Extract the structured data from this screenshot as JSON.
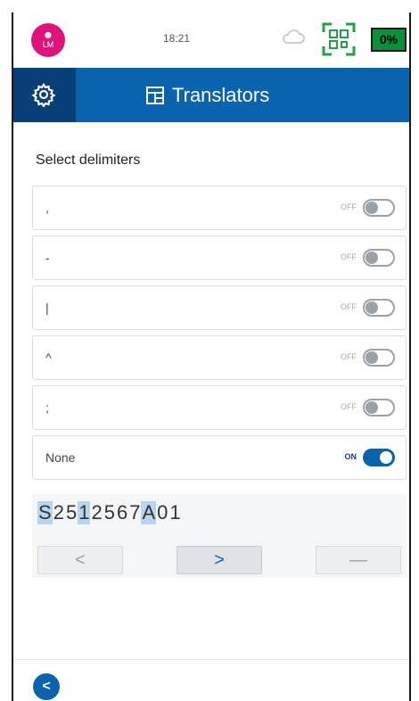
{
  "status": {
    "avatar_initials": "LM",
    "time": "18:21",
    "battery": "0%"
  },
  "header": {
    "title": "Translators",
    "icon": "translators-icon",
    "settings_icon": "gear-icon"
  },
  "section_title": "Select delimiters",
  "delimiters": [
    {
      "label": ",",
      "state": "OFF",
      "on": false
    },
    {
      "label": "-",
      "state": "OFF",
      "on": false
    },
    {
      "label": "|",
      "state": "OFF",
      "on": false
    },
    {
      "label": "^",
      "state": "OFF",
      "on": false
    },
    {
      "label": ";",
      "state": "OFF",
      "on": false
    },
    {
      "label": "None",
      "state": "ON",
      "on": true
    }
  ],
  "preview": {
    "characters": [
      "S",
      "2",
      "5",
      "1",
      "2",
      "5",
      "6",
      "7",
      "A",
      "0",
      "1"
    ],
    "highlighted": [
      0,
      3,
      8
    ]
  },
  "nav": {
    "prev": "<",
    "next": ">",
    "clear": "—"
  },
  "footer": {
    "back": "<"
  },
  "colors": {
    "header_blue": "#0b62ad",
    "header_dark": "#083f77",
    "avatar_pink": "#e0137d",
    "battery_green": "#0a8f3d"
  }
}
